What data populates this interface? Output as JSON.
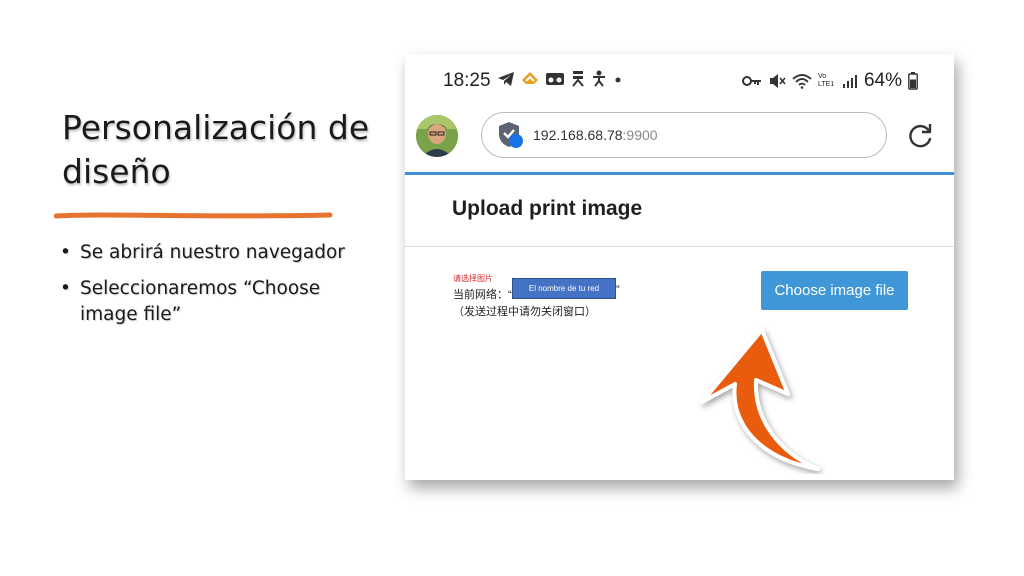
{
  "slide": {
    "title": "Personalización de diseño",
    "accent_color": "#e6742e",
    "bullets": [
      {
        "text": "Se abrirá nuestro navegador"
      },
      {
        "text": "Seleccionaremos “Choose image file”"
      }
    ]
  },
  "phone": {
    "status_bar": {
      "time": "18:25",
      "left_icons": [
        "telegram-icon",
        "feedly-icon",
        "voicemail-icon",
        "hotspot-icon",
        "accessibility-icon",
        "dot-icon"
      ],
      "right_icons": [
        "vpn-key-icon",
        "mute-icon",
        "wifi-icon",
        "volte-icon",
        "signal-icon"
      ],
      "volte_label": "Vo LTE1",
      "battery_percent": "64%"
    },
    "browser": {
      "url_host": "192.168.68.78",
      "url_port": ":9900",
      "accent_color": "#3d8fd6"
    },
    "page": {
      "heading": "Upload print image",
      "hint_red": "请选择图片",
      "network_label": "当前网络：“",
      "network_name": "El nombre de tu red",
      "network_close": "”",
      "note": "（发送过程中请勿关闭窗口）",
      "choose_button": "Choose image file",
      "button_color": "#3f97d8"
    }
  }
}
